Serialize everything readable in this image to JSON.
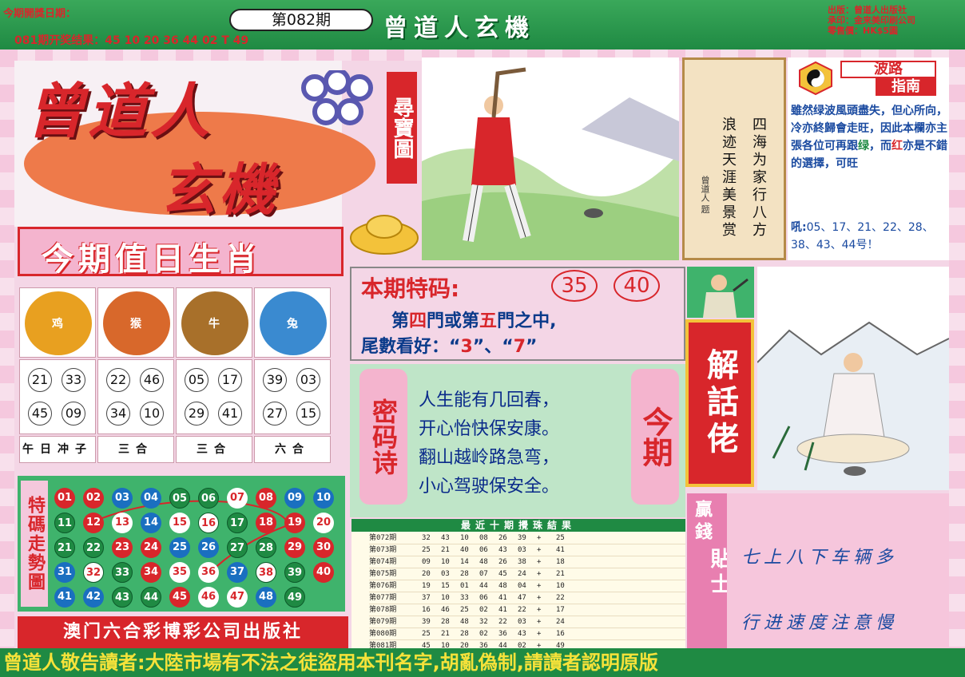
{
  "header": {
    "draw_date_label": "今期開獎日期：",
    "prev_results": "081期开奖结果：45 10 20 36 44 02 T 49",
    "issue": "第082期",
    "brand_title": "曾道人玄機",
    "publisher_info": [
      "出版：曾道人出版社",
      "承印：金来美印刷公司",
      "零售價：HK$5圓"
    ]
  },
  "logo": {
    "word1": "曾道人",
    "word2": "玄機",
    "treasure_label": "尋寶圖"
  },
  "poem_scroll": {
    "col1": "四海为家行八方",
    "col2": "浪迹天涯美景赏",
    "signature": "曾道人 题"
  },
  "guide": {
    "title1": "波路",
    "title2": "指南",
    "text_a": "雖然绿波風頭盡失，但心所向，冷亦終歸會走旺，因此本欄亦主張各位可再跟",
    "text_green": "绿",
    "text_b": "，而",
    "text_red": "红",
    "text_c": "亦是不錯的選擇，可旺",
    "text_prefix": "吼:",
    "numbers": "05、17、21、22、28、38、43、44号！"
  },
  "zodiac": {
    "banner": "今期值日生肖",
    "animals": [
      {
        "name": "鸡",
        "color": "#e8a020",
        "nums": [
          "21",
          "33",
          "45",
          "09"
        ],
        "relation": "午日冲子"
      },
      {
        "name": "猴",
        "color": "#d8682b",
        "nums": [
          "22",
          "46",
          "34",
          "10"
        ],
        "relation": "三合"
      },
      {
        "name": "牛",
        "color": "#a8702a",
        "nums": [
          "05",
          "17",
          "29",
          "41"
        ],
        "relation": "三合"
      },
      {
        "name": "兔",
        "color": "#3a8ad0",
        "nums": [
          "39",
          "03",
          "27",
          "15"
        ],
        "relation": "六合"
      }
    ]
  },
  "trend": {
    "label": "特碼走勢圖",
    "balls": [
      [
        "01",
        "02",
        "03",
        "04",
        "05",
        "06",
        "07",
        "08",
        "09",
        "10"
      ],
      [
        "11",
        "12",
        "13",
        "14",
        "15",
        "16",
        "17",
        "18",
        "19",
        "20"
      ],
      [
        "21",
        "22",
        "23",
        "24",
        "25",
        "26",
        "27",
        "28",
        "29",
        "30"
      ],
      [
        "31",
        "32",
        "33",
        "34",
        "35",
        "36",
        "37",
        "38",
        "39",
        "40"
      ],
      [
        "41",
        "42",
        "43",
        "44",
        "45",
        "46",
        "47",
        "48",
        "49"
      ]
    ],
    "colors": [
      [
        "r",
        "r",
        "b",
        "b",
        "g",
        "g",
        "r",
        "r",
        "b",
        "b"
      ],
      [
        "g",
        "r",
        "r",
        "b",
        "b",
        "g",
        "g",
        "r",
        "r",
        "b"
      ],
      [
        "g",
        "g",
        "r",
        "r",
        "b",
        "b",
        "g",
        "g",
        "r",
        "r"
      ],
      [
        "b",
        "g",
        "g",
        "r",
        "r",
        "b",
        "b",
        "g",
        "g",
        "r"
      ],
      [
        "b",
        "b",
        "g",
        "g",
        "r",
        "r",
        "b",
        "b",
        "g"
      ]
    ],
    "highlighted": [
      "07",
      "13",
      "15",
      "16",
      "20",
      "32",
      "35",
      "36",
      "38",
      "46",
      "47"
    ]
  },
  "publisher_banner": "澳门六合彩博彩公司出版社",
  "special": {
    "title": "本期特码:",
    "num1": "35",
    "num2": "40",
    "line1_a": "第",
    "line1_b": "四",
    "line1_c": "門或第",
    "line1_d": "五",
    "line1_e": "門之中,",
    "line2_a": "尾數看好：“",
    "line2_b": "3",
    "line2_c": "”、“",
    "line2_d": "7",
    "line2_e": "”"
  },
  "secret_poem": {
    "left_label": "密码诗",
    "right_label": "今期",
    "lines": [
      "人生能有几回春，",
      "开心怡快保安康。",
      "翻山越岭路急弯，",
      "小心驾驶保安全。"
    ]
  },
  "recent_results": {
    "header": "最近十期攪珠結果",
    "rows": [
      {
        "period": "第072期",
        "nums": [
          "32",
          "43",
          "10",
          "08",
          "26",
          "39"
        ],
        "special": "25"
      },
      {
        "period": "第073期",
        "nums": [
          "25",
          "21",
          "40",
          "06",
          "43",
          "03"
        ],
        "special": "41"
      },
      {
        "period": "第074期",
        "nums": [
          "09",
          "10",
          "14",
          "48",
          "26",
          "38"
        ],
        "special": "18"
      },
      {
        "period": "第075期",
        "nums": [
          "20",
          "03",
          "28",
          "07",
          "45",
          "24"
        ],
        "special": "21"
      },
      {
        "period": "第076期",
        "nums": [
          "19",
          "15",
          "01",
          "44",
          "48",
          "04"
        ],
        "special": "10"
      },
      {
        "period": "第077期",
        "nums": [
          "37",
          "10",
          "33",
          "06",
          "41",
          "47"
        ],
        "special": "22"
      },
      {
        "period": "第078期",
        "nums": [
          "16",
          "46",
          "25",
          "02",
          "41",
          "22"
        ],
        "special": "17"
      },
      {
        "period": "第079期",
        "nums": [
          "39",
          "28",
          "48",
          "32",
          "22",
          "03"
        ],
        "special": "24"
      },
      {
        "period": "第080期",
        "nums": [
          "25",
          "21",
          "28",
          "02",
          "36",
          "43"
        ],
        "special": "16"
      },
      {
        "period": "第081期",
        "nums": [
          "45",
          "10",
          "20",
          "36",
          "44",
          "02"
        ],
        "special": "49"
      }
    ]
  },
  "solution": {
    "banner": "解話佬"
  },
  "tips": {
    "label_a": "贏錢",
    "label_b": "貼士",
    "line1": "七上八下车辆多",
    "line2": "行进速度注意慢"
  },
  "footer": "曾道人敬告讀者:大陸市場有不法之徒盜用本刊名字,胡亂偽制,請讀者認明原版"
}
